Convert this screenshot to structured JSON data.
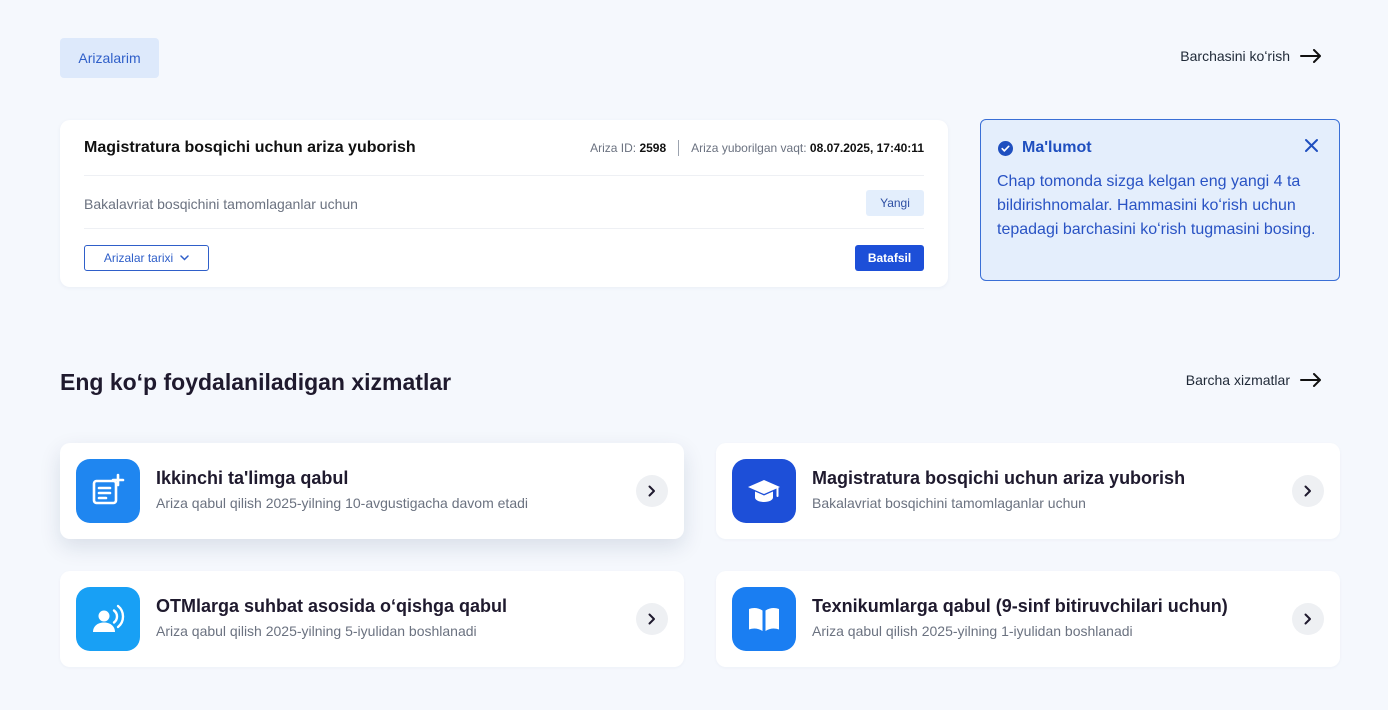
{
  "header": {
    "tab_label": "Arizalarim",
    "see_all_label": "Barchasini koʻrish"
  },
  "application": {
    "title": "Magistratura bosqichi uchun ariza yuborish",
    "id_label": "Ariza ID:",
    "id_value": "2598",
    "sent_label": "Ariza yuborilgan vaqt:",
    "sent_value": "08.07.2025, 17:40:11",
    "description": "Bakalavriat bosqichini tamomlaganlar uchun",
    "status": "Yangi",
    "history_label": "Arizalar tarixi",
    "details_label": "Batafsil"
  },
  "info": {
    "title": "Ma'lumot",
    "body": "Chap tomonda sizga kelgan eng yangi 4 ta bildirishnomalar. Hammasini koʻrish uchun tepadagi barchasini koʻrish tugmasini bosing."
  },
  "services_section": {
    "title": "Eng koʻp foydalaniladigan xizmatlar",
    "see_all_label": "Barcha xizmatlar"
  },
  "services": [
    {
      "title": "Ikkinchi ta'limga qabul",
      "subtitle": "Ariza qabul qilish 2025-yilning 10-avgustigacha davom etadi",
      "icon": "document-add-icon",
      "icon_color": "#1f86f0"
    },
    {
      "title": "Magistratura bosqichi uchun ariza yuborish",
      "subtitle": "Bakalavriat bosqichini tamomlaganlar uchun",
      "icon": "graduation-cap-icon",
      "icon_color": "#1d4fd8"
    },
    {
      "title": "OTMlarga suhbat asosida oʻqishga qabul",
      "subtitle": "Ariza qabul qilish 2025-yilning 5-iyulidan boshlanadi",
      "icon": "user-speaking-icon",
      "icon_color": "#18a0f5"
    },
    {
      "title": "Texnikumlarga qabul (9-sinf bitiruvchilari uchun)",
      "subtitle": "Ariza qabul qilish 2025-yilning 1-iyulidan boshlanadi",
      "icon": "book-icon",
      "icon_color": "#1a7ef2"
    }
  ],
  "colors": {
    "accent": "#1d4fd8",
    "background": "#f5f8fd",
    "info_bg": "#e4eefc"
  }
}
